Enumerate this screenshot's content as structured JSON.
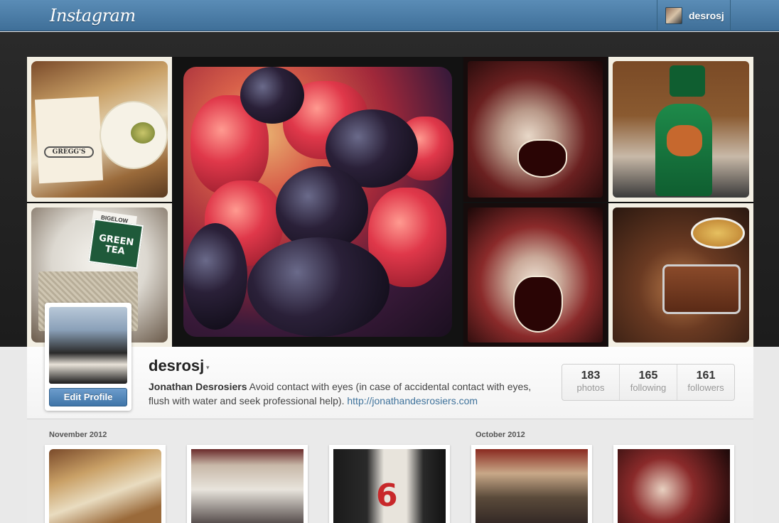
{
  "app": {
    "logo": "Instagram"
  },
  "topbar": {
    "username": "desrosj"
  },
  "mosaic": {
    "tile1_tag": "GREGG'S",
    "tile2_brand": "BIGELOW",
    "tile2_label": "GREEN TEA"
  },
  "profile": {
    "username": "desrosj",
    "caret": "▾",
    "edit_button": "Edit Profile",
    "full_name": "Jonathan Desrosiers",
    "bio": " Avoid contact with eyes (in case of accidental contact with eyes, flush with water and seek professional help). ",
    "website": "http://jonathandesrosiers.com",
    "stats": [
      {
        "value": "183",
        "label": "photos"
      },
      {
        "value": "165",
        "label": "following"
      },
      {
        "value": "161",
        "label": "followers"
      }
    ]
  },
  "timeline": {
    "months": [
      "November 2012",
      "October 2012"
    ],
    "thumb3_number": "6"
  }
}
